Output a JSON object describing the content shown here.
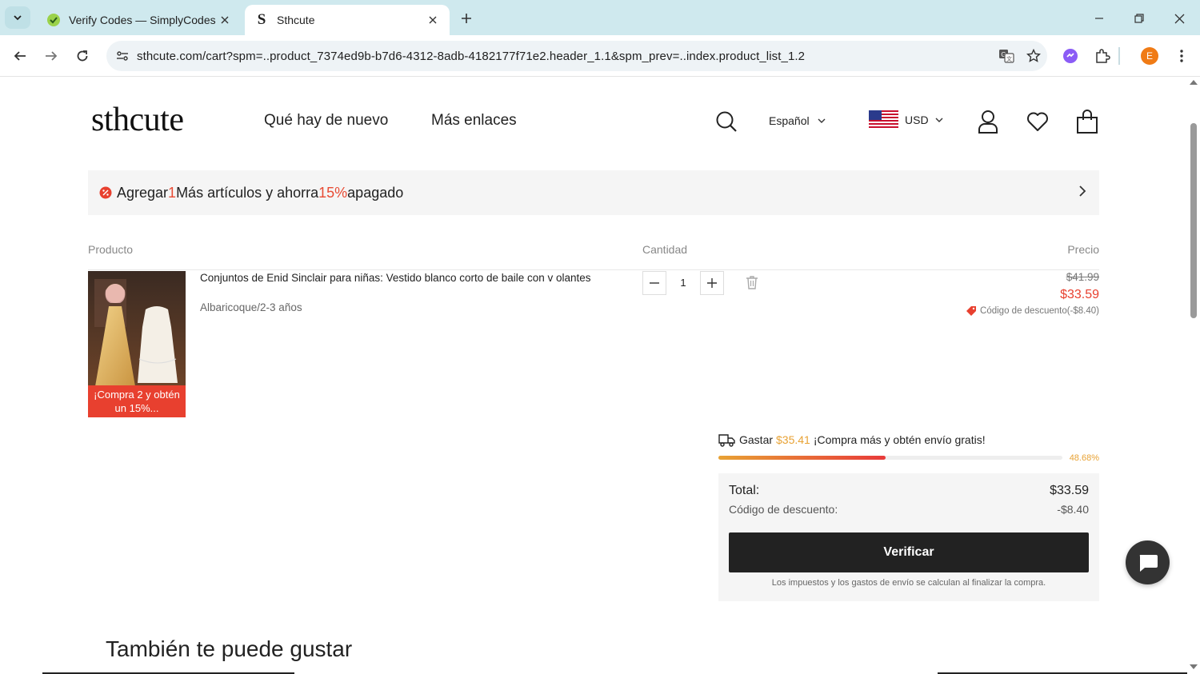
{
  "browser": {
    "tabs": [
      {
        "title": "Verify Codes — SimplyCodes",
        "active": false
      },
      {
        "title": "Sthcute",
        "active": true
      }
    ],
    "url": "sthcute.com/cart?spm=..product_7374ed9b-b7d6-4312-8adb-4182177f71e2.header_1.1&spm_prev=..index.product_list_1.2",
    "profile_initial": "E"
  },
  "header": {
    "logo": "sthcute",
    "nav": [
      "Qué hay de nuevo",
      "Más enlaces"
    ],
    "language": "Español",
    "currency": "USD"
  },
  "promo": {
    "prefix": "Agregar",
    "count": "1",
    "middle": "Más artículos y ahorra",
    "percent": "15%",
    "suffix": "apagado"
  },
  "cart": {
    "columns": {
      "product": "Producto",
      "quantity": "Cantidad",
      "price": "Precio"
    },
    "item": {
      "name": "Conjuntos de Enid Sinclair para niñas: Vestido blanco corto de baile con v olantes",
      "variant": "Albaricoque/2-3 años",
      "badge": "¡Compra 2 y obtén un 15%...",
      "quantity": "1",
      "price_original": "$41.99",
      "price_current": "$33.59",
      "discount_note": "Código de descuento(-$8.40)"
    }
  },
  "shipping": {
    "prefix": "Gastar",
    "amount": "$35.41",
    "suffix": "¡Compra más y obtén envío gratis!",
    "progress_label": "48.68%",
    "progress_fraction": 0.4868
  },
  "summary": {
    "total_label": "Total:",
    "total_value": "$33.59",
    "discount_label": "Código de descuento:",
    "discount_value": "-$8.40",
    "checkout_label": "Verificar",
    "tax_note": "Los impuestos y los gastos de envío se calculan al finalizar la compra."
  },
  "recommendations": {
    "title": "También te puede gustar"
  },
  "colors": {
    "accent_red": "#e8402f",
    "accent_orange": "#e8a234",
    "dark": "#222222"
  }
}
